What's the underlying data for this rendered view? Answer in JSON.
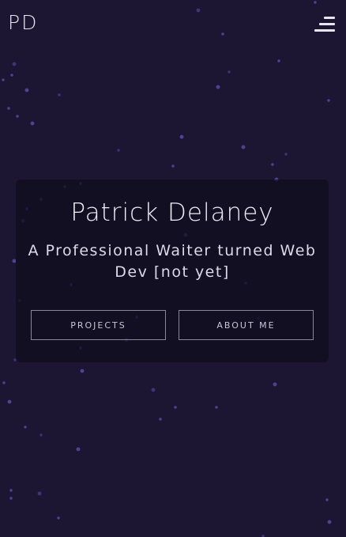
{
  "header": {
    "logo": "PD",
    "menu_icon": "hamburger-menu-icon"
  },
  "hero": {
    "name": "Patrick Delaney",
    "tagline": "A Professional Waiter turned Web Dev [not yet]",
    "buttons": {
      "projects": "PROJECTS",
      "about": "ABOUT ME"
    }
  },
  "colors": {
    "background": "#1c1633",
    "particle": "#5b4fb0",
    "card": "#0f0c1c",
    "text": "#efedf6"
  }
}
